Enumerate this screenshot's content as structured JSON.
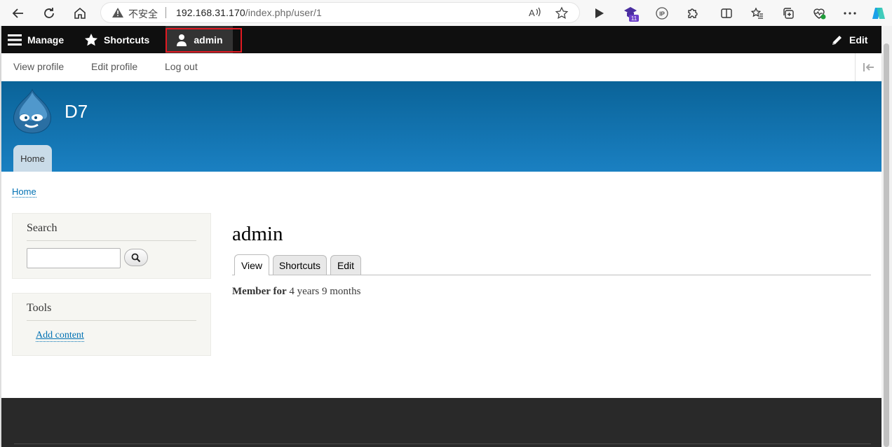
{
  "browser": {
    "security_label": "不安全",
    "url_host": "192.168.31.170",
    "url_path": "/index.php/user/1",
    "ext_badge": "11",
    "ip_ext": "IP"
  },
  "toolbar": {
    "manage": "Manage",
    "shortcuts": "Shortcuts",
    "user": "admin",
    "edit": "Edit"
  },
  "tray": {
    "view_profile": "View profile",
    "edit_profile": "Edit profile",
    "log_out": "Log out"
  },
  "site": {
    "name": "D7",
    "home_tab": "Home"
  },
  "breadcrumb": "Home",
  "sidebar": {
    "search_title": "Search",
    "search_value": "",
    "tools_title": "Tools",
    "tools_link": "Add content"
  },
  "main": {
    "title": "admin",
    "tabs": [
      {
        "label": "View",
        "active": true
      },
      {
        "label": "Shortcuts",
        "active": false
      },
      {
        "label": "Edit",
        "active": false
      }
    ],
    "member_label": "Member for",
    "member_value": "4 years 9 months"
  },
  "colors": {
    "header_top": "#0a6398",
    "header_bottom": "#1a80c2",
    "toolbar": "#0f0f0f",
    "link": "#0071b3",
    "highlight": "#e11a22"
  }
}
